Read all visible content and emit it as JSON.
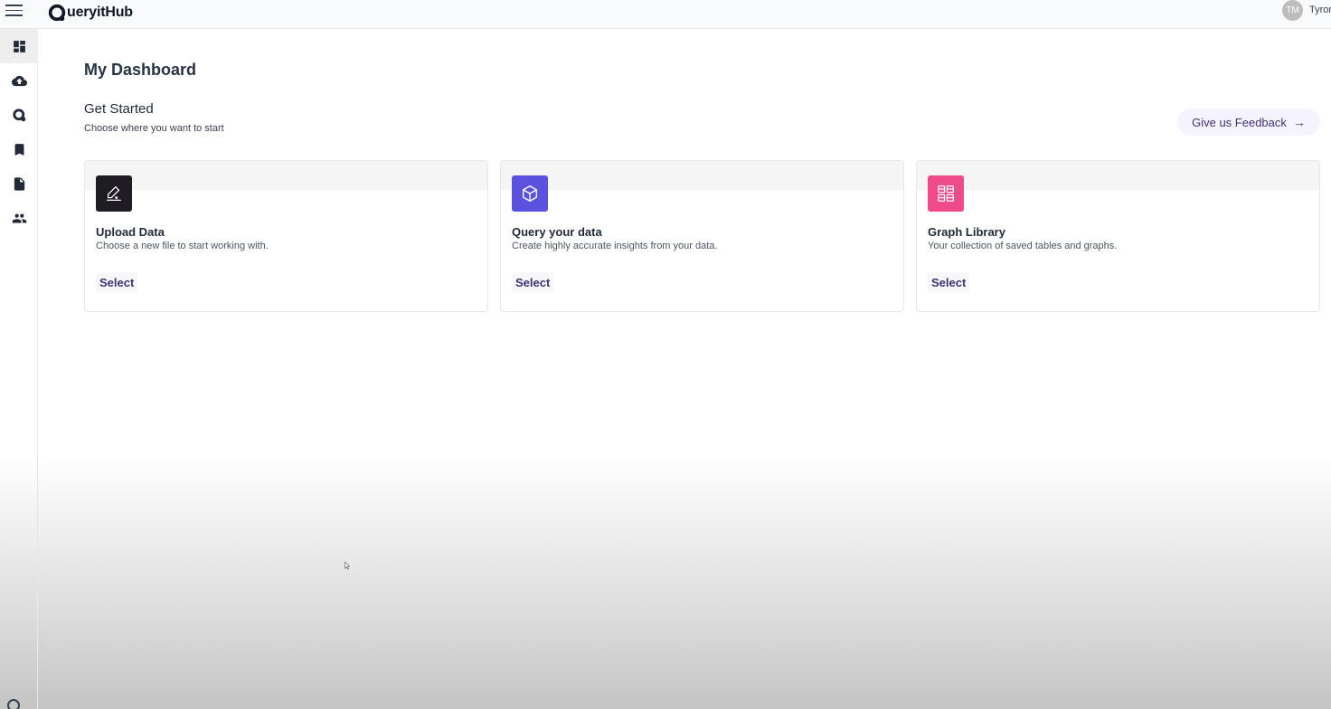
{
  "app": {
    "brand_text": "ueryitHub",
    "user_initials": "TM",
    "user_name": "Tyror"
  },
  "sidebar": {
    "items": [
      {
        "icon": "dashboard-icon",
        "active": true
      },
      {
        "icon": "cloud-upload-icon",
        "active": false
      },
      {
        "icon": "query-logo-icon",
        "active": false
      },
      {
        "icon": "bookmark-icon",
        "active": false
      },
      {
        "icon": "document-icon",
        "active": false
      },
      {
        "icon": "people-icon",
        "active": false
      }
    ]
  },
  "main": {
    "title": "My Dashboard",
    "section_title": "Get Started",
    "section_subtitle": "Choose where you want to start",
    "feedback_label": "Give us Feedback",
    "feedback_arrow": "→",
    "cards": [
      {
        "title": "Upload Data",
        "description": "Choose a new file to start working with.",
        "action": "Select",
        "icon": "edit-pen-icon",
        "color": "#1f1c24"
      },
      {
        "title": "Query your data",
        "description": "Create highly accurate insights from your data.",
        "action": "Select",
        "icon": "cube-icon",
        "color": "#5b53e0"
      },
      {
        "title": "Graph Library",
        "description": "Your collection of saved tables and graphs.",
        "action": "Select",
        "icon": "grid-icon",
        "color": "#ef4a8a"
      }
    ]
  }
}
